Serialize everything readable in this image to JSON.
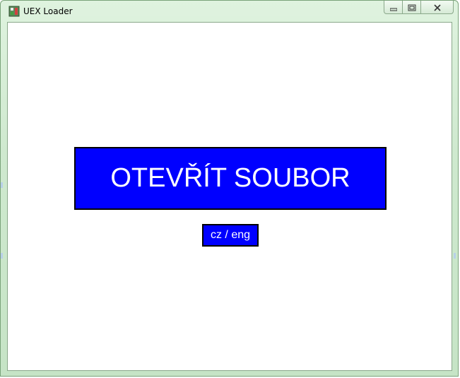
{
  "window": {
    "title": "UEX Loader",
    "minimize_label": "",
    "maximize_label": "",
    "close_label": ""
  },
  "main": {
    "open_button_label": "OTEVŘÍT SOUBOR",
    "language_button_label": "cz / eng"
  },
  "icons": {
    "app": "app-icon",
    "minimize": "minimize-icon",
    "maximize": "maximize-icon",
    "close": "close-icon"
  },
  "colors": {
    "button_fill": "#0000ff",
    "button_text": "#ffffff",
    "button_border": "#000000",
    "frame": "#c6e4c6"
  }
}
